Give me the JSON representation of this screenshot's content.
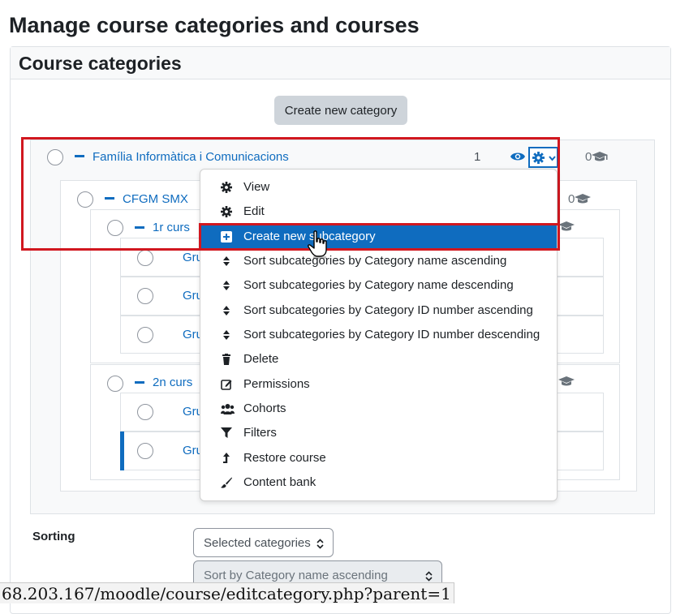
{
  "page": {
    "title": "Manage course categories and courses"
  },
  "panel": {
    "title": "Course categories",
    "create_category_label": "Create new category"
  },
  "tree": {
    "top": {
      "name": "Família Informàtica i Comunicacions",
      "count": "1",
      "courses": "0"
    },
    "level2": {
      "name": "CFGM SMX",
      "courses": "0"
    },
    "level3a": {
      "name": "1r curs"
    },
    "level3a_children": [
      "Gru",
      "Gru",
      "Gru"
    ],
    "level3b": {
      "name": "2n curs"
    },
    "level3b_children": [
      "Gru",
      "Gru"
    ]
  },
  "menu": {
    "items": [
      {
        "label": "View",
        "icon": "gear-icon"
      },
      {
        "label": "Edit",
        "icon": "gear-icon"
      },
      {
        "label": "Create new subcategory",
        "icon": "plus-square-icon"
      },
      {
        "label": "Sort subcategories by Category name ascending",
        "icon": "sort-icon"
      },
      {
        "label": "Sort subcategories by Category name descending",
        "icon": "sort-icon"
      },
      {
        "label": "Sort subcategories by Category ID number ascending",
        "icon": "sort-icon"
      },
      {
        "label": "Sort subcategories by Category ID number descending",
        "icon": "sort-icon"
      },
      {
        "label": "Delete",
        "icon": "trash-icon"
      },
      {
        "label": "Permissions",
        "icon": "pencil-square-icon"
      },
      {
        "label": "Cohorts",
        "icon": "users-icon"
      },
      {
        "label": "Filters",
        "icon": "filter-icon"
      },
      {
        "label": "Restore course",
        "icon": "restore-icon"
      },
      {
        "label": "Content bank",
        "icon": "brush-icon"
      }
    ]
  },
  "sorting": {
    "label": "Sorting",
    "selected_categories": "Selected categories",
    "sort_by": "Sort by Category name ascending"
  },
  "status_bar": {
    "url": "68.203.167/moodle/course/editcategory.php?parent=1"
  },
  "colors": {
    "link": "#0f6cbf",
    "highlight": "#d1171f",
    "button_bg": "#ced4da"
  }
}
